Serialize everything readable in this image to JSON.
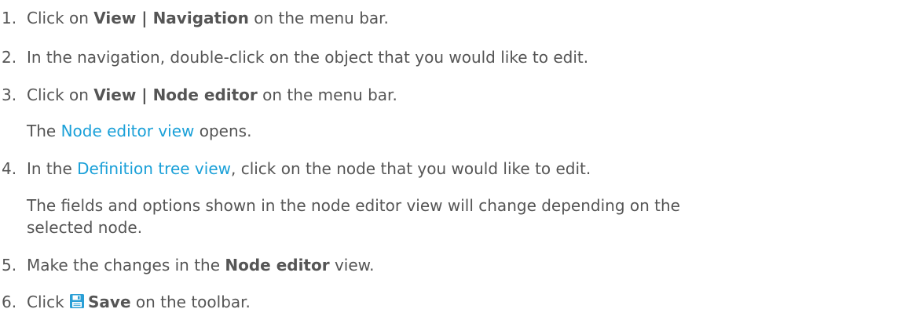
{
  "steps": [
    {
      "num": "1.",
      "pre": "Click on ",
      "bold1": "View",
      "sep": " | ",
      "bold2": "Navigation",
      "post": " on the menu bar."
    },
    {
      "num": "2.",
      "text": "In the navigation, double-click on the object that you would like to edit."
    },
    {
      "num": "3.",
      "pre": "Click on ",
      "bold1": "View",
      "sep": " | ",
      "bold2": "Node editor",
      "post": " on the menu bar."
    },
    {
      "note_pre": "The ",
      "note_link": "Node editor view",
      "note_post": " opens."
    },
    {
      "num": "4.",
      "pre": "In the ",
      "link": "Definition tree view",
      "post": ", click on the node that you would like to edit."
    },
    {
      "note_line1": "The fields and options shown in the node editor view will change depending on the",
      "note_line2": "selected node."
    },
    {
      "num": "5.",
      "pre": "Make the changes in the ",
      "bold": "Node editor",
      "post": " view."
    },
    {
      "num": "6.",
      "pre": "Click ",
      "bold": "Save",
      "post": " on the toolbar."
    }
  ],
  "icons": {
    "save": "save-icon"
  },
  "colors": {
    "text": "#555555",
    "link": "#1aa0d8",
    "icon": "#2a9fd6"
  }
}
